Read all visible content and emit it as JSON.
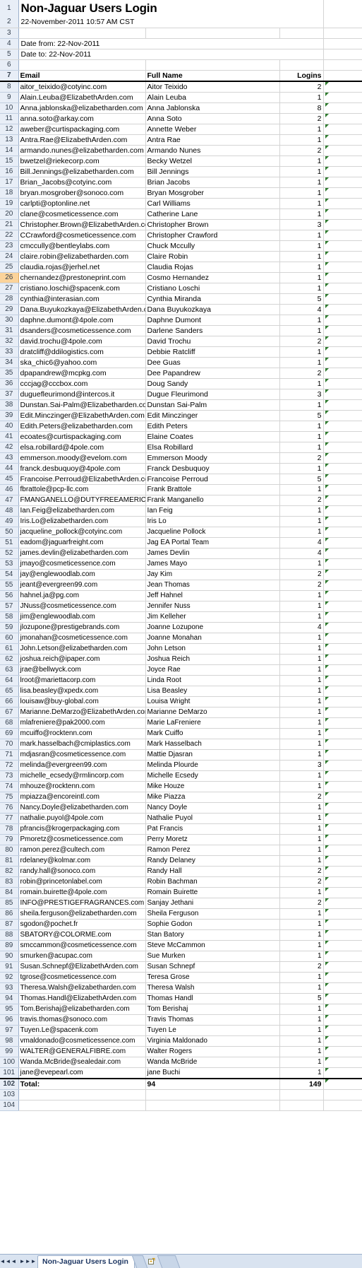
{
  "document": {
    "title": "Non-Jaguar Users Login",
    "timestamp": "22-November-2011 10:57 AM CST",
    "date_from": "Date from: 22-Nov-2011",
    "date_to": "Date to: 22-Nov-2011"
  },
  "columns": {
    "email": "Email",
    "full_name": "Full Name",
    "logins": "Logins"
  },
  "selected_row": 26,
  "rows": [
    {
      "n": 8,
      "email": "aitor_teixido@cotyinc.com",
      "name": "Aitor Teixido",
      "logins": "2"
    },
    {
      "n": 9,
      "email": "Alain.Leuba@ElizabethArden.com",
      "name": "Alain Leuba",
      "logins": "1"
    },
    {
      "n": 10,
      "email": "Anna.jablonska@elizabetharden.com",
      "name": "Anna Jablonska",
      "logins": "8"
    },
    {
      "n": 11,
      "email": "anna.soto@arkay.com",
      "name": "Anna Soto",
      "logins": "2"
    },
    {
      "n": 12,
      "email": "aweber@curtispackaging.com",
      "name": "Annette Weber",
      "logins": "1"
    },
    {
      "n": 13,
      "email": "Antra.Rae@ElizabethArden.com",
      "name": "Antra Rae",
      "logins": "1"
    },
    {
      "n": 14,
      "email": "armando.nunes@elizabetharden.com",
      "name": "Armando Nunes",
      "logins": "2"
    },
    {
      "n": 15,
      "email": "bwetzel@riekecorp.com",
      "name": "Becky Wetzel",
      "logins": "1"
    },
    {
      "n": 16,
      "email": "Bill.Jennings@elizabetharden.com",
      "name": "Bill Jennings",
      "logins": "1"
    },
    {
      "n": 17,
      "email": "Brian_Jacobs@cotyinc.com",
      "name": "Brian Jacobs",
      "logins": "1"
    },
    {
      "n": 18,
      "email": "bryan.mosgrober@sonoco.com",
      "name": "Bryan Mosgrober",
      "logins": "1"
    },
    {
      "n": 19,
      "email": "carlpti@optonline.net",
      "name": "Carl Williams",
      "logins": "1"
    },
    {
      "n": 20,
      "email": "clane@cosmeticessence.com",
      "name": "Catherine Lane",
      "logins": "1"
    },
    {
      "n": 21,
      "email": "Christopher.Brown@ElizabethArden.com",
      "name": "Christopher Brown",
      "logins": "3"
    },
    {
      "n": 22,
      "email": "CCrawford@cosmeticessence.com",
      "name": "Christopher Crawford",
      "logins": "1"
    },
    {
      "n": 23,
      "email": "cmccully@bentleylabs.com",
      "name": "Chuck Mccully",
      "logins": "1"
    },
    {
      "n": 24,
      "email": "claire.robin@elizabetharden.com",
      "name": "Claire Robin",
      "logins": "1"
    },
    {
      "n": 25,
      "email": "claudia.rojas@jerhel.net",
      "name": "Claudia Rojas",
      "logins": "1"
    },
    {
      "n": 26,
      "email": "chernandez@prestoneprint.com",
      "name": "Cosmo Hernandez",
      "logins": "1"
    },
    {
      "n": 27,
      "email": "cristiano.loschi@spacenk.com",
      "name": "Cristiano Loschi",
      "logins": "1"
    },
    {
      "n": 28,
      "email": "cynthia@interasian.com",
      "name": "Cynthia Miranda",
      "logins": "5"
    },
    {
      "n": 29,
      "email": "Dana.Buyukozkaya@ElizabethArden.com",
      "name": "Dana Buyukozkaya",
      "logins": "4"
    },
    {
      "n": 30,
      "email": "daphne.dumont@4pole.com",
      "name": "Daphne Dumont",
      "logins": "1"
    },
    {
      "n": 31,
      "email": "dsanders@cosmeticessence.com",
      "name": "Darlene Sanders",
      "logins": "1"
    },
    {
      "n": 32,
      "email": "david.trochu@4pole.com",
      "name": "David Trochu",
      "logins": "2"
    },
    {
      "n": 33,
      "email": "dratcliff@ddilogistics.com",
      "name": "Debbie Ratcliff",
      "logins": "1"
    },
    {
      "n": 34,
      "email": "ska_chic6@yahoo.com",
      "name": "Dee Guas",
      "logins": "1"
    },
    {
      "n": 35,
      "email": "dpapandrew@mcpkg.com",
      "name": "Dee Papandrew",
      "logins": "2"
    },
    {
      "n": 36,
      "email": "cccjag@cccbox.com",
      "name": "Doug Sandy",
      "logins": "1"
    },
    {
      "n": 37,
      "email": "duguefleurimond@intercos.it",
      "name": "Dugue Fleurimond",
      "logins": "3"
    },
    {
      "n": 38,
      "email": "Dunstan.Sai-Palm@Elizabetharden.com",
      "name": "Dunstan Sai-Palm",
      "logins": "1"
    },
    {
      "n": 39,
      "email": "Edit.Minczinger@ElizabethArden.com",
      "name": "Edit Minczinger",
      "logins": "5"
    },
    {
      "n": 40,
      "email": "Edith.Peters@elizabetharden.com",
      "name": "Edith  Peters",
      "logins": "1"
    },
    {
      "n": 41,
      "email": "ecoates@curtispackaging.com",
      "name": "Elaine Coates",
      "logins": "1"
    },
    {
      "n": 42,
      "email": "elsa.robillard@4pole.com",
      "name": "Elsa Robillard",
      "logins": "1"
    },
    {
      "n": 43,
      "email": "emmerson.moody@evelom.com",
      "name": "Emmerson Moody",
      "logins": "2"
    },
    {
      "n": 44,
      "email": "franck.desbuquoy@4pole.com",
      "name": "Franck Desbuquoy",
      "logins": "1"
    },
    {
      "n": 45,
      "email": "Francoise.Perroud@ElizabethArden.com",
      "name": "Francoise Perroud",
      "logins": "5"
    },
    {
      "n": 46,
      "email": "fbrattole@pcp-llc.com",
      "name": "Frank Brattole",
      "logins": "1"
    },
    {
      "n": 47,
      "email": "FMANGANELLO@DUTYFREEAMERICAS.com",
      "name": "Frank Manganello",
      "logins": "2"
    },
    {
      "n": 48,
      "email": "Ian.Feig@elizabetharden.com",
      "name": "Ian Feig",
      "logins": "1"
    },
    {
      "n": 49,
      "email": "Iris.Lo@elizabetharden.com",
      "name": "Iris Lo",
      "logins": "1"
    },
    {
      "n": 50,
      "email": "jacqueline_pollock@cotyinc.com",
      "name": "Jacqueline Pollock",
      "logins": "1"
    },
    {
      "n": 51,
      "email": "eadom@jaguarfreight.com",
      "name": "Jag EA Portal Team",
      "logins": "4"
    },
    {
      "n": 52,
      "email": "james.devlin@elizabetharden.com",
      "name": "James Devlin",
      "logins": "4"
    },
    {
      "n": 53,
      "email": "jmayo@cosmeticessence.com",
      "name": "James Mayo",
      "logins": "1"
    },
    {
      "n": 54,
      "email": "jay@englewoodlab.com",
      "name": "Jay Kim",
      "logins": "2"
    },
    {
      "n": 55,
      "email": "jeant@evergreen99.com",
      "name": "Jean Thomas",
      "logins": "2"
    },
    {
      "n": 56,
      "email": "hahnel.ja@pg.com",
      "name": "Jeff Hahnel",
      "logins": "1"
    },
    {
      "n": 57,
      "email": "JNuss@cosmeticessence.com",
      "name": "Jennifer  Nuss",
      "logins": "1"
    },
    {
      "n": 58,
      "email": "jim@englewoodlab.com",
      "name": "Jim Kelleher",
      "logins": "1"
    },
    {
      "n": 59,
      "email": "jlozupone@prestigebrands.com",
      "name": "Joanne Lozupone",
      "logins": "4"
    },
    {
      "n": 60,
      "email": "jmonahan@cosmeticessence.com",
      "name": "Joanne Monahan",
      "logins": "1"
    },
    {
      "n": 61,
      "email": "John.Letson@elizabetharden.com",
      "name": "John Letson",
      "logins": "1"
    },
    {
      "n": 62,
      "email": "joshua.reich@ipaper.com",
      "name": "Joshua Reich",
      "logins": "1"
    },
    {
      "n": 63,
      "email": "jrae@bellwyck.com",
      "name": "Joyce Rae",
      "logins": "1"
    },
    {
      "n": 64,
      "email": "lroot@mariettacorp.com",
      "name": "Linda Root",
      "logins": "1"
    },
    {
      "n": 65,
      "email": "lisa.beasley@xpedx.com",
      "name": "Lisa Beasley",
      "logins": "1"
    },
    {
      "n": 66,
      "email": "louisaw@buy-global.com",
      "name": "Louisa Wright",
      "logins": "1"
    },
    {
      "n": 67,
      "email": "Marianne.DeMarzo@ElizabethArden.com",
      "name": "Marianne DeMarzo",
      "logins": "1"
    },
    {
      "n": 68,
      "email": "mlafreniere@pak2000.com",
      "name": "Marie LaFreniere",
      "logins": "1"
    },
    {
      "n": 69,
      "email": "mcuiffo@rocktenn.com",
      "name": "Mark Cuiffo",
      "logins": "1"
    },
    {
      "n": 70,
      "email": "mark.hasselbach@cmiplastics.com",
      "name": "Mark Hasselbach",
      "logins": "1"
    },
    {
      "n": 71,
      "email": "mdjasran@cosmeticessence.com",
      "name": "Mattie Djasran",
      "logins": "1"
    },
    {
      "n": 72,
      "email": "melinda@evergreen99.com",
      "name": "Melinda Plourde",
      "logins": "3"
    },
    {
      "n": 73,
      "email": "michelle_ecsedy@rmlincorp.com",
      "name": "Michelle Ecsedy",
      "logins": "1"
    },
    {
      "n": 74,
      "email": "mhouze@rocktenn.com",
      "name": "Mike Houze",
      "logins": "1"
    },
    {
      "n": 75,
      "email": "mpiazza@encoreintl.com",
      "name": "Mike Piazza",
      "logins": "2"
    },
    {
      "n": 76,
      "email": "Nancy.Doyle@elizabetharden.com",
      "name": "Nancy Doyle",
      "logins": "1"
    },
    {
      "n": 77,
      "email": "nathalie.puyol@4pole.com",
      "name": "Nathalie Puyol",
      "logins": "1"
    },
    {
      "n": 78,
      "email": "pfrancis@krogerpackaging.com",
      "name": "Pat Francis",
      "logins": "1"
    },
    {
      "n": 79,
      "email": "Pmoretz@cosmeticessence.com",
      "name": "Perry Moretz",
      "logins": "1"
    },
    {
      "n": 80,
      "email": "ramon.perez@cultech.com",
      "name": "Ramon Perez",
      "logins": "1"
    },
    {
      "n": 81,
      "email": "rdelaney@kolmar.com",
      "name": "Randy Delaney",
      "logins": "1"
    },
    {
      "n": 82,
      "email": "randy.hall@sonoco.com",
      "name": "Randy Hall",
      "logins": "2"
    },
    {
      "n": 83,
      "email": "robin@princetonlabel.com",
      "name": "Robin Bachman",
      "logins": "2"
    },
    {
      "n": 84,
      "email": "romain.buirette@4pole.com",
      "name": "Romain Buirette",
      "logins": "1"
    },
    {
      "n": 85,
      "email": "INFO@PRESTIGEFRAGRANCES.com",
      "name": "Sanjay Jethani",
      "logins": "2"
    },
    {
      "n": 86,
      "email": "sheila.ferguson@elizabetharden.com",
      "name": "Sheila Ferguson",
      "logins": "1"
    },
    {
      "n": 87,
      "email": "sgodon@pochet.fr",
      "name": "Sophie Godon",
      "logins": "1"
    },
    {
      "n": 88,
      "email": "SBATORY@COLORME.com",
      "name": "Stan Batory",
      "logins": "1"
    },
    {
      "n": 89,
      "email": "smccammon@cosmeticessence.com",
      "name": "Steve McCammon",
      "logins": "1"
    },
    {
      "n": 90,
      "email": "smurken@acupac.com",
      "name": "Sue Murken",
      "logins": "1"
    },
    {
      "n": 91,
      "email": "Susan.Schnepf@ElizabethArden.com",
      "name": "Susan Schnepf",
      "logins": "2"
    },
    {
      "n": 92,
      "email": "tgrose@cosmeticessence.com",
      "name": "Teresa Grose",
      "logins": "1"
    },
    {
      "n": 93,
      "email": "Theresa.Walsh@elizabetharden.com",
      "name": "Theresa Walsh",
      "logins": "1"
    },
    {
      "n": 94,
      "email": "Thomas.Handl@ElizabethArden.com",
      "name": "Thomas Handl",
      "logins": "5"
    },
    {
      "n": 95,
      "email": "Tom.Berishaj@elizabetharden.com",
      "name": "Tom Berishaj",
      "logins": "1"
    },
    {
      "n": 96,
      "email": "travis.thomas@sonoco.com",
      "name": "Travis Thomas",
      "logins": "1"
    },
    {
      "n": 97,
      "email": "Tuyen.Le@spacenk.com",
      "name": "Tuyen Le",
      "logins": "1"
    },
    {
      "n": 98,
      "email": "vmaldonado@cosmeticessence.com",
      "name": "Virginia Maldonado",
      "logins": "1"
    },
    {
      "n": 99,
      "email": "WALTER@GENERALFIBRE.com",
      "name": "Walter Rogers",
      "logins": "1"
    },
    {
      "n": 100,
      "email": "Wanda.McBride@sealedair.com",
      "name": "Wanda McBride",
      "logins": "1"
    },
    {
      "n": 101,
      "email": "jane@evepearl.com",
      "name": "jane Buchi",
      "logins": "1"
    }
  ],
  "total": {
    "label": "Total:",
    "name_count": "94",
    "logins_sum": "149"
  },
  "trailing_row_numbers": [
    102,
    103,
    104
  ],
  "tabbar": {
    "first_icon": "◄◄",
    "prev_icon": "◄",
    "next_icon": "►",
    "last_icon": "►►",
    "sheet_name": "Non-Jaguar Users Login",
    "new_sheet_icon": "insert-sheet-icon"
  }
}
